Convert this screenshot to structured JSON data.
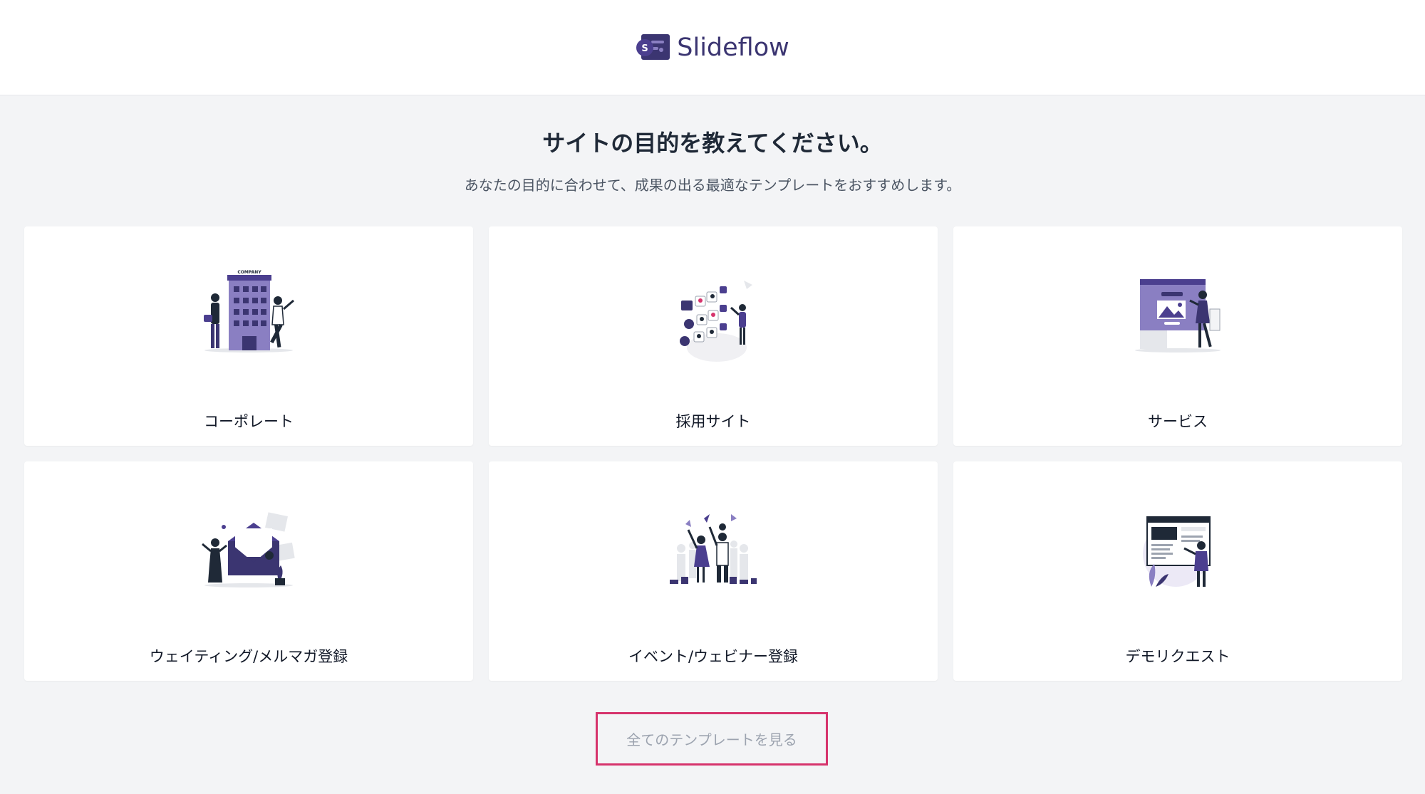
{
  "header": {
    "logo_text": "Slideflow",
    "logo_letter": "S"
  },
  "heading": "サイトの目的を教えてください。",
  "subheading": "あなたの目的に合わせて、成果の出る最適なテンプレートをおすすめします。",
  "cards": [
    {
      "label": "コーポレート",
      "icon": "corporate-illustration"
    },
    {
      "label": "採用サイト",
      "icon": "recruit-illustration"
    },
    {
      "label": "サービス",
      "icon": "service-illustration"
    },
    {
      "label": "ウェイティング/メルマガ登録",
      "icon": "newsletter-illustration"
    },
    {
      "label": "イベント/ウェビナー登録",
      "icon": "event-illustration"
    },
    {
      "label": "デモリクエスト",
      "icon": "demo-request-illustration"
    }
  ],
  "illustration_texts": {
    "company_sign": "COMPANY"
  },
  "all_templates_button": "全てのテンプレートを見る",
  "colors": {
    "accent": "#d6336c",
    "brand": "#3b3571",
    "illustration_purple": "#4b3f8f",
    "illustration_light": "#8a7fc2"
  }
}
